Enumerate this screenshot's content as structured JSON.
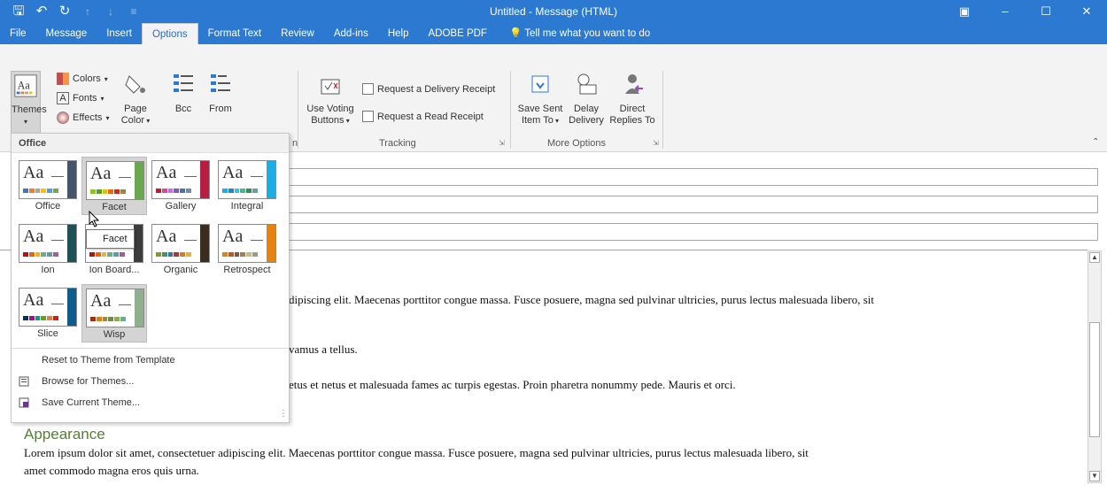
{
  "window": {
    "title": "Untitled - Message (HTML)",
    "qat": [
      "save-icon",
      "undo-icon",
      "redo-icon",
      "up-icon",
      "down-icon",
      "customize-icon"
    ],
    "controls": [
      "ribbon-display-icon",
      "minimize-icon",
      "maximize-icon",
      "close-icon"
    ]
  },
  "tabs": [
    {
      "label": "File"
    },
    {
      "label": "Message"
    },
    {
      "label": "Insert"
    },
    {
      "label": "Options",
      "active": true
    },
    {
      "label": "Format Text"
    },
    {
      "label": "Review"
    },
    {
      "label": "Add-ins"
    },
    {
      "label": "Help"
    },
    {
      "label": "ADOBE PDF"
    },
    {
      "label": "Tell me what you want to do"
    }
  ],
  "ribbon": {
    "themes": {
      "label": "Themes",
      "colors": "Colors",
      "fonts": "Fonts",
      "effects": "Effects",
      "page_color_1": "Page",
      "page_color_2": "Color"
    },
    "bcc": "Bcc",
    "from": "From",
    "use_voting_1": "Use Voting",
    "use_voting_2": "Buttons",
    "delivery_receipt": "Request a Delivery Receipt",
    "read_receipt": "Request a Read Receipt",
    "tracking_label": "Tracking",
    "save_sent_1": "Save Sent",
    "save_sent_2": "Item To",
    "delay_1": "Delay",
    "delay_2": "Delivery",
    "direct_1": "Direct",
    "direct_2": "Replies To",
    "more_options_label": "More Options",
    "partial_label": "n"
  },
  "dropdown": {
    "header": "Office",
    "themes": [
      {
        "name": "Office",
        "colors": [
          "#4472c4",
          "#ed7d31",
          "#a5a5a5",
          "#ffc000",
          "#5b9bd5",
          "#70ad47"
        ],
        "edge": "#44546a"
      },
      {
        "name": "Facet",
        "colors": [
          "#90c226",
          "#54a021",
          "#e6b91e",
          "#e76618",
          "#c42f1a",
          "#918655"
        ],
        "edge": "#6aa84f",
        "highlight": true
      },
      {
        "name": "Gallery",
        "colors": [
          "#b71e42",
          "#de478e",
          "#bc72f0",
          "#795faf",
          "#586ea6",
          "#6892a0"
        ],
        "edge": "#b71e42"
      },
      {
        "name": "Integral",
        "colors": [
          "#1cade4",
          "#2683c6",
          "#27ced7",
          "#42ba97",
          "#3e8853",
          "#62a39f"
        ],
        "edge": "#1cade4"
      },
      {
        "name": "Ion",
        "colors": [
          "#b01513",
          "#ea6312",
          "#e6b729",
          "#6aac90",
          "#5f9c9d",
          "#9e5e9b"
        ],
        "edge": "#1e5155"
      },
      {
        "name": "Ion Board...",
        "colors": [
          "#b01513",
          "#ea6312",
          "#e6b729",
          "#6bab90",
          "#5f9c9d",
          "#9e5e9b"
        ],
        "edge": "#3c3c3c"
      },
      {
        "name": "Organic",
        "colors": [
          "#83992a",
          "#3c9770",
          "#44709d",
          "#a23c33",
          "#d97828",
          "#deb340"
        ],
        "edge": "#3a2c1e"
      },
      {
        "name": "Retrospect",
        "colors": [
          "#e48312",
          "#bd582c",
          "#865640",
          "#9b8357",
          "#c2bc80",
          "#94a088"
        ],
        "edge": "#e48312"
      },
      {
        "name": "Slice",
        "colors": [
          "#052f61",
          "#a50e82",
          "#14967c",
          "#6a9e1f",
          "#e87d37",
          "#c62324"
        ],
        "edge": "#0e5c8c"
      },
      {
        "name": "Wisp",
        "colors": [
          "#a53010",
          "#de7e18",
          "#9f8351",
          "#728653",
          "#92aa4c",
          "#6aac91"
        ],
        "edge": "#8fb08c",
        "highlight": true
      }
    ],
    "tooltip": "Facet",
    "reset": "Reset to Theme from Template",
    "browse": "Browse for Themes...",
    "save": "Save Current Theme..."
  },
  "body": {
    "line1": "dipiscing elit. Maecenas porttitor congue massa. Fusce posuere, magna sed pulvinar ultricies, purus lectus malesuada libero, sit",
    "line2": "vamus a tellus.",
    "line3": "etus et netus et malesuada fames ac turpis egestas. Proin pharetra nonummy pede. Mauris et orci.",
    "heading": "Appearance",
    "line4": "Lorem ipsum dolor sit amet, consectetuer adipiscing elit. Maecenas porttitor congue massa. Fusce posuere, magna sed pulvinar ultricies, purus lectus malesuada libero, sit",
    "line5": "amet commodo magna eros quis urna."
  }
}
